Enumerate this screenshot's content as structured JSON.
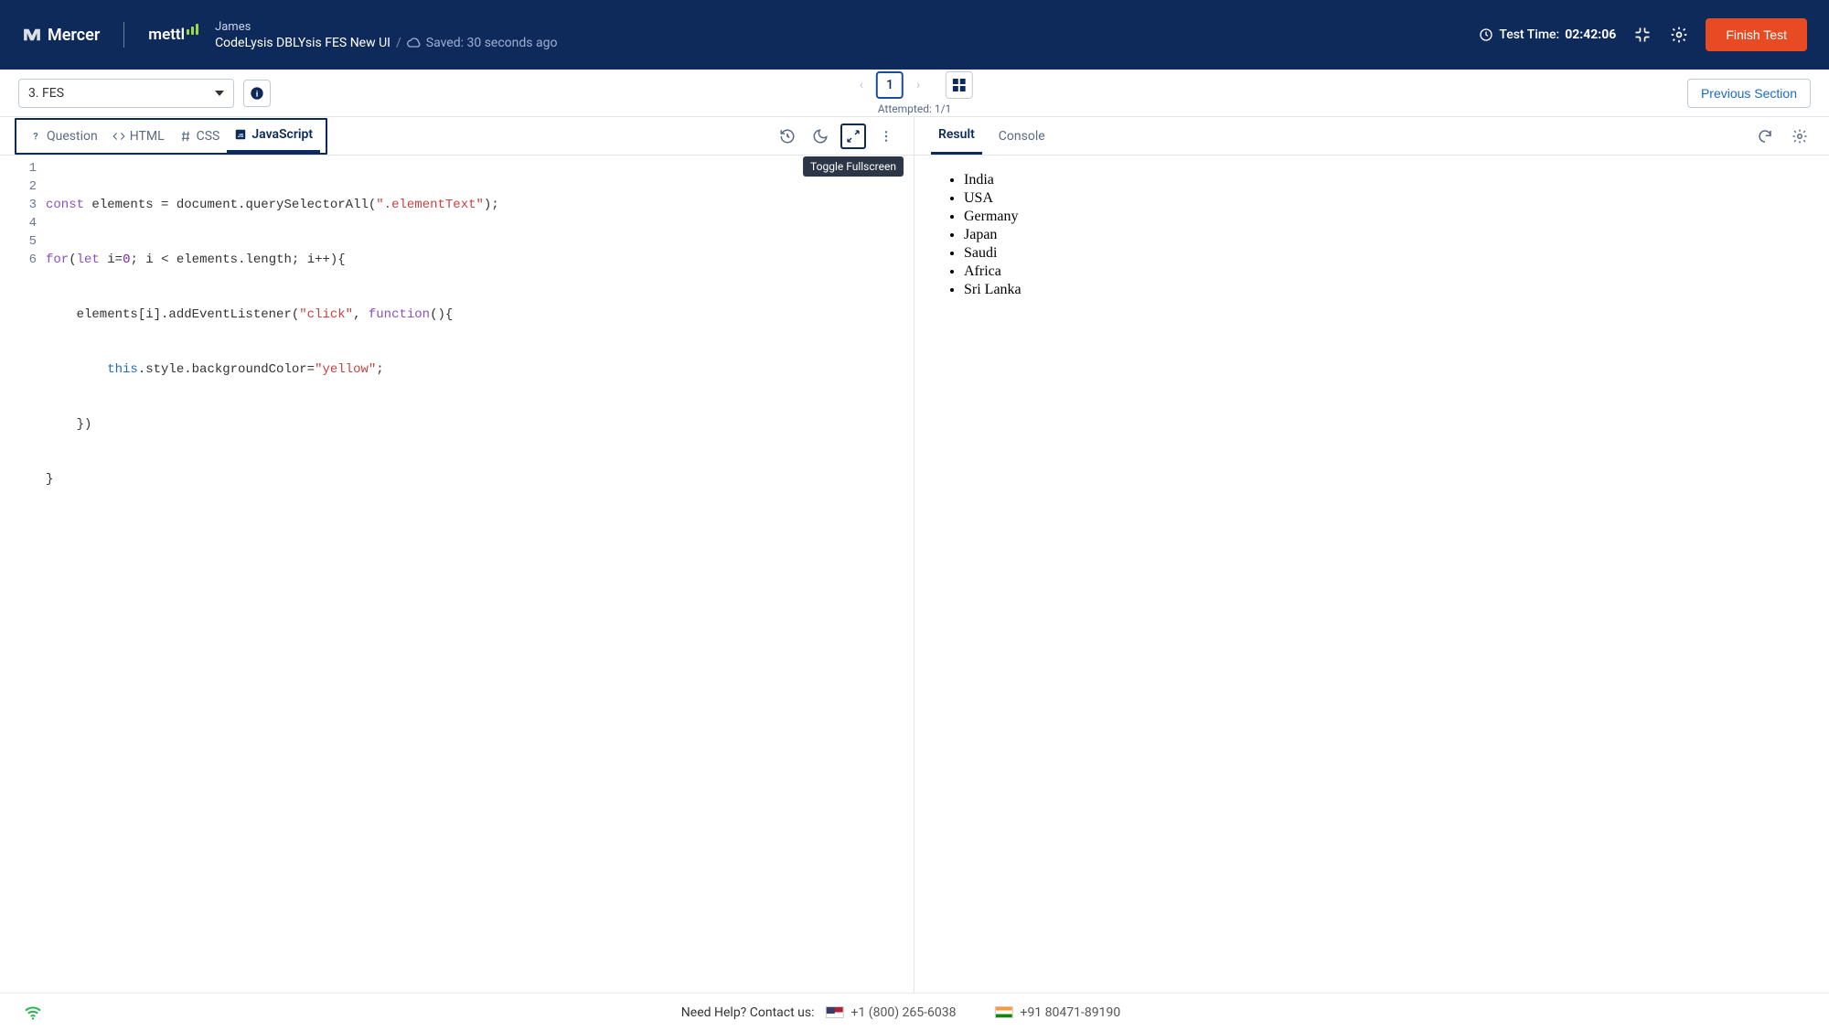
{
  "header": {
    "brand1": "Mercer",
    "brand2": "mettl",
    "user": "James",
    "breadcrumb_title": "CodeLysis DBLYsis FES New UI",
    "saved_label": "Saved: 30 seconds ago",
    "test_time_label": "Test Time:",
    "test_time_value": "02:42:06",
    "finish_label": "Finish Test"
  },
  "subheader": {
    "section_select": "3. FES",
    "page_number": "1",
    "attempted": "Attempted: 1/1",
    "prev_section": "Previous Section"
  },
  "editor": {
    "tabs": {
      "question": "Question",
      "html": "HTML",
      "css": "CSS",
      "javascript": "JavaScript"
    },
    "tooltip_fullscreen": "Toggle Fullscreen",
    "lines": [
      "1",
      "2",
      "3",
      "4",
      "5",
      "6"
    ],
    "code": {
      "l1_a": "const",
      "l1_b": " elements = document.querySelectorAll(",
      "l1_c": "\".elementText\"",
      "l1_d": ");",
      "l2_a": "for",
      "l2_b": "(",
      "l2_c": "let",
      "l2_d": " i=",
      "l2_e": "0",
      "l2_f": "; i < elements.length; i++){",
      "l3_a": "    elements[i].addEventListener(",
      "l3_b": "\"click\"",
      "l3_c": ", ",
      "l3_d": "function",
      "l3_e": "(){",
      "l4_a": "        ",
      "l4_b": "this",
      "l4_c": ".style.backgroundColor=",
      "l4_d": "\"yellow\"",
      "l4_e": ";",
      "l5": "    })",
      "l6": "}"
    }
  },
  "result": {
    "tab_result": "Result",
    "tab_console": "Console",
    "items": [
      "India",
      "USA",
      "Germany",
      "Japan",
      "Saudi",
      "Africa",
      "Sri Lanka"
    ]
  },
  "footer": {
    "help_label": "Need Help? Contact us:",
    "phone_us": "+1 (800) 265-6038",
    "phone_in": "+91 80471-89190"
  }
}
